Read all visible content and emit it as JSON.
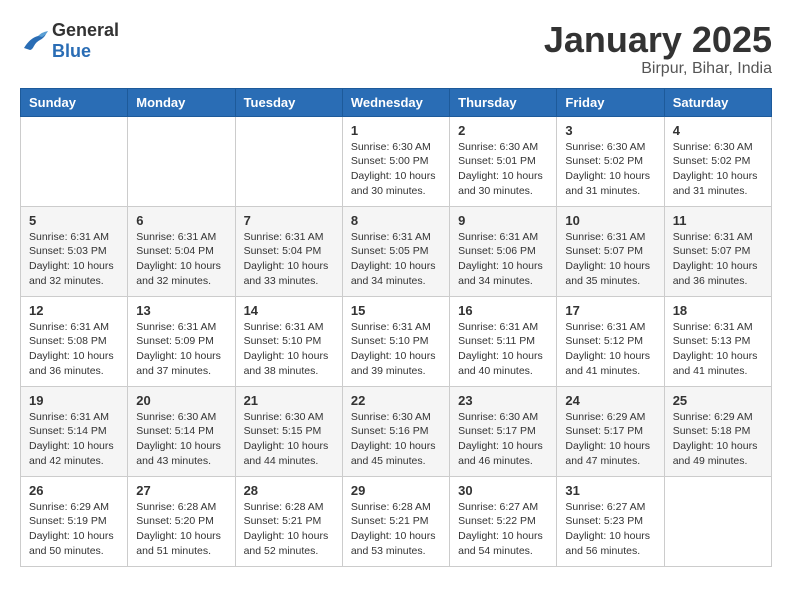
{
  "header": {
    "logo": {
      "general": "General",
      "blue": "Blue"
    },
    "title": "January 2025",
    "location": "Birpur, Bihar, India"
  },
  "calendar": {
    "days_of_week": [
      "Sunday",
      "Monday",
      "Tuesday",
      "Wednesday",
      "Thursday",
      "Friday",
      "Saturday"
    ],
    "weeks": [
      [
        {
          "day": "",
          "info": ""
        },
        {
          "day": "",
          "info": ""
        },
        {
          "day": "",
          "info": ""
        },
        {
          "day": "1",
          "info": "Sunrise: 6:30 AM\nSunset: 5:00 PM\nDaylight: 10 hours\nand 30 minutes."
        },
        {
          "day": "2",
          "info": "Sunrise: 6:30 AM\nSunset: 5:01 PM\nDaylight: 10 hours\nand 30 minutes."
        },
        {
          "day": "3",
          "info": "Sunrise: 6:30 AM\nSunset: 5:02 PM\nDaylight: 10 hours\nand 31 minutes."
        },
        {
          "day": "4",
          "info": "Sunrise: 6:30 AM\nSunset: 5:02 PM\nDaylight: 10 hours\nand 31 minutes."
        }
      ],
      [
        {
          "day": "5",
          "info": "Sunrise: 6:31 AM\nSunset: 5:03 PM\nDaylight: 10 hours\nand 32 minutes."
        },
        {
          "day": "6",
          "info": "Sunrise: 6:31 AM\nSunset: 5:04 PM\nDaylight: 10 hours\nand 32 minutes."
        },
        {
          "day": "7",
          "info": "Sunrise: 6:31 AM\nSunset: 5:04 PM\nDaylight: 10 hours\nand 33 minutes."
        },
        {
          "day": "8",
          "info": "Sunrise: 6:31 AM\nSunset: 5:05 PM\nDaylight: 10 hours\nand 34 minutes."
        },
        {
          "day": "9",
          "info": "Sunrise: 6:31 AM\nSunset: 5:06 PM\nDaylight: 10 hours\nand 34 minutes."
        },
        {
          "day": "10",
          "info": "Sunrise: 6:31 AM\nSunset: 5:07 PM\nDaylight: 10 hours\nand 35 minutes."
        },
        {
          "day": "11",
          "info": "Sunrise: 6:31 AM\nSunset: 5:07 PM\nDaylight: 10 hours\nand 36 minutes."
        }
      ],
      [
        {
          "day": "12",
          "info": "Sunrise: 6:31 AM\nSunset: 5:08 PM\nDaylight: 10 hours\nand 36 minutes."
        },
        {
          "day": "13",
          "info": "Sunrise: 6:31 AM\nSunset: 5:09 PM\nDaylight: 10 hours\nand 37 minutes."
        },
        {
          "day": "14",
          "info": "Sunrise: 6:31 AM\nSunset: 5:10 PM\nDaylight: 10 hours\nand 38 minutes."
        },
        {
          "day": "15",
          "info": "Sunrise: 6:31 AM\nSunset: 5:10 PM\nDaylight: 10 hours\nand 39 minutes."
        },
        {
          "day": "16",
          "info": "Sunrise: 6:31 AM\nSunset: 5:11 PM\nDaylight: 10 hours\nand 40 minutes."
        },
        {
          "day": "17",
          "info": "Sunrise: 6:31 AM\nSunset: 5:12 PM\nDaylight: 10 hours\nand 41 minutes."
        },
        {
          "day": "18",
          "info": "Sunrise: 6:31 AM\nSunset: 5:13 PM\nDaylight: 10 hours\nand 41 minutes."
        }
      ],
      [
        {
          "day": "19",
          "info": "Sunrise: 6:31 AM\nSunset: 5:14 PM\nDaylight: 10 hours\nand 42 minutes."
        },
        {
          "day": "20",
          "info": "Sunrise: 6:30 AM\nSunset: 5:14 PM\nDaylight: 10 hours\nand 43 minutes."
        },
        {
          "day": "21",
          "info": "Sunrise: 6:30 AM\nSunset: 5:15 PM\nDaylight: 10 hours\nand 44 minutes."
        },
        {
          "day": "22",
          "info": "Sunrise: 6:30 AM\nSunset: 5:16 PM\nDaylight: 10 hours\nand 45 minutes."
        },
        {
          "day": "23",
          "info": "Sunrise: 6:30 AM\nSunset: 5:17 PM\nDaylight: 10 hours\nand 46 minutes."
        },
        {
          "day": "24",
          "info": "Sunrise: 6:29 AM\nSunset: 5:17 PM\nDaylight: 10 hours\nand 47 minutes."
        },
        {
          "day": "25",
          "info": "Sunrise: 6:29 AM\nSunset: 5:18 PM\nDaylight: 10 hours\nand 49 minutes."
        }
      ],
      [
        {
          "day": "26",
          "info": "Sunrise: 6:29 AM\nSunset: 5:19 PM\nDaylight: 10 hours\nand 50 minutes."
        },
        {
          "day": "27",
          "info": "Sunrise: 6:28 AM\nSunset: 5:20 PM\nDaylight: 10 hours\nand 51 minutes."
        },
        {
          "day": "28",
          "info": "Sunrise: 6:28 AM\nSunset: 5:21 PM\nDaylight: 10 hours\nand 52 minutes."
        },
        {
          "day": "29",
          "info": "Sunrise: 6:28 AM\nSunset: 5:21 PM\nDaylight: 10 hours\nand 53 minutes."
        },
        {
          "day": "30",
          "info": "Sunrise: 6:27 AM\nSunset: 5:22 PM\nDaylight: 10 hours\nand 54 minutes."
        },
        {
          "day": "31",
          "info": "Sunrise: 6:27 AM\nSunset: 5:23 PM\nDaylight: 10 hours\nand 56 minutes."
        },
        {
          "day": "",
          "info": ""
        }
      ]
    ]
  }
}
